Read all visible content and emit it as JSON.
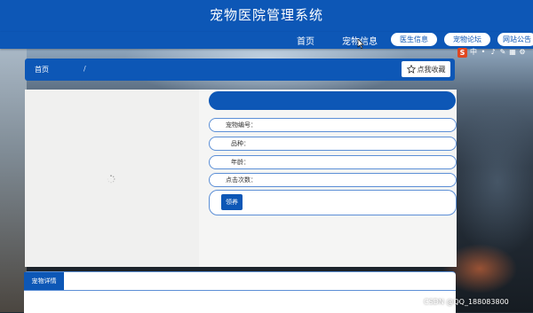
{
  "app": {
    "title": "宠物医院管理系统"
  },
  "nav": {
    "items": [
      {
        "label": "首页"
      },
      {
        "label": "宠物信息"
      },
      {
        "label": "医生信息"
      },
      {
        "label": "宠物论坛"
      },
      {
        "label": "网站公告"
      }
    ]
  },
  "ime": {
    "logo": "S",
    "icons": [
      "中",
      "•",
      "♪",
      "✎",
      "▦",
      "⚙"
    ]
  },
  "breadcrumb": {
    "home": "首页",
    "separator": "/",
    "favorite_label": "点我收藏"
  },
  "pet": {
    "fields": [
      {
        "label": "宠物编号："
      },
      {
        "label": "品种："
      },
      {
        "label": "年龄："
      },
      {
        "label": "点击次数："
      }
    ],
    "adopt_label": "领养"
  },
  "details": {
    "tab_label": "宠物详情"
  },
  "watermark": "CSDN @QQ_188083800",
  "colors": {
    "primary": "#0d57b6",
    "border": "#5c8fd6"
  }
}
